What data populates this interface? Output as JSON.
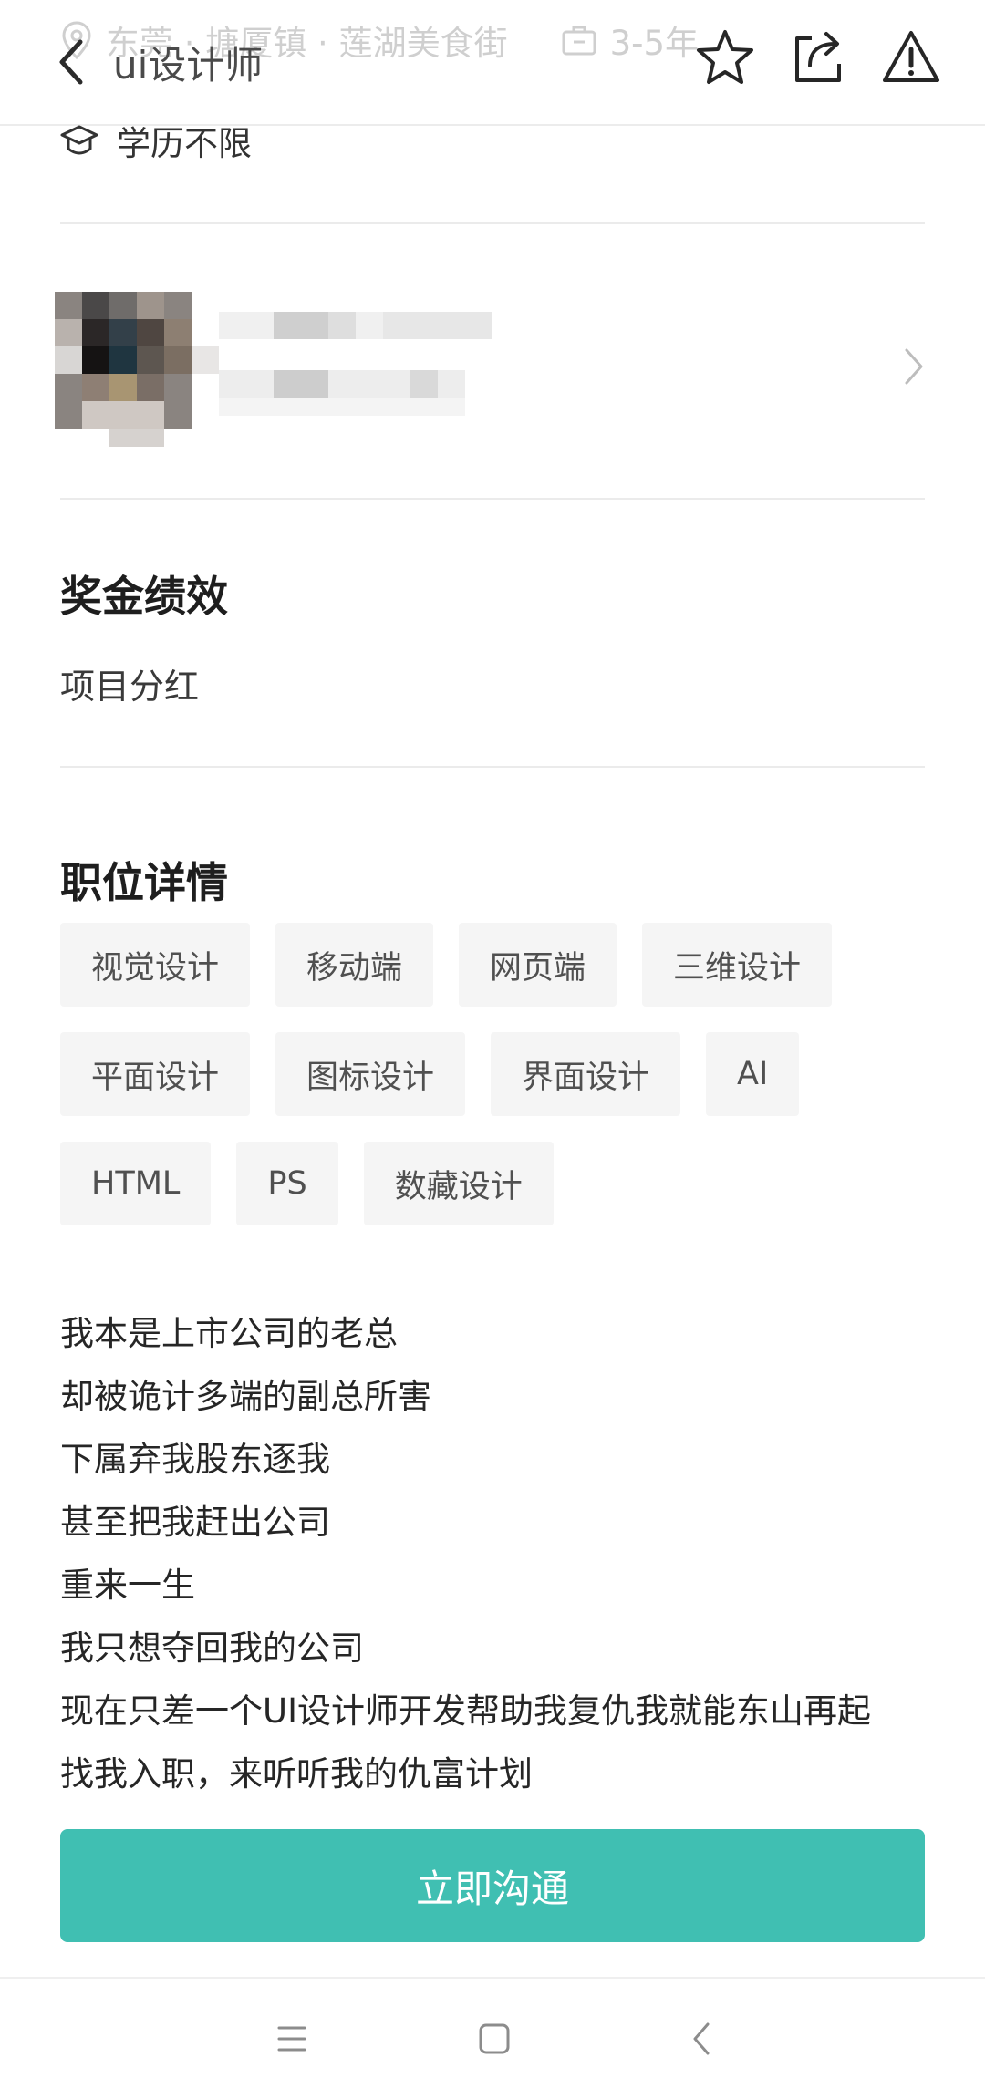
{
  "header": {
    "title": "ui设计师",
    "underlay_location": "东莞 · 塘厦镇 · 莲湖美食街",
    "underlay_experience": "3-5年",
    "actions": [
      "star-icon",
      "share-icon",
      "report-icon"
    ]
  },
  "requirements": {
    "education": "学历不限"
  },
  "bonus": {
    "title": "奖金绩效",
    "text": "项目分红"
  },
  "job_detail": {
    "title": "职位详情",
    "tags": [
      [
        "视觉设计",
        "移动端",
        "网页端",
        "三维设计"
      ],
      [
        "平面设计",
        "图标设计",
        "界面设计",
        "AI"
      ],
      [
        "HTML",
        "PS",
        "数藏设计"
      ]
    ],
    "description": [
      "我本是上市公司的老总",
      "却被诡计多端的副总所害",
      "下属弃我股东逐我",
      "甚至把我赶出公司",
      "重来一生",
      "我只想夺回我的公司",
      "现在只差一个UI设计师开发帮助我复仇我就能东山再起",
      "找我入职，来听听我的仇富计划"
    ]
  },
  "cta": {
    "label": "立即沟通"
  },
  "colors": {
    "accent": "#40bfb2",
    "tag_bg": "#f5f5f5",
    "divider": "#ebebeb"
  },
  "navbar": {
    "icons": [
      "menu-icon",
      "home-square-icon",
      "back-chevron-icon"
    ]
  }
}
